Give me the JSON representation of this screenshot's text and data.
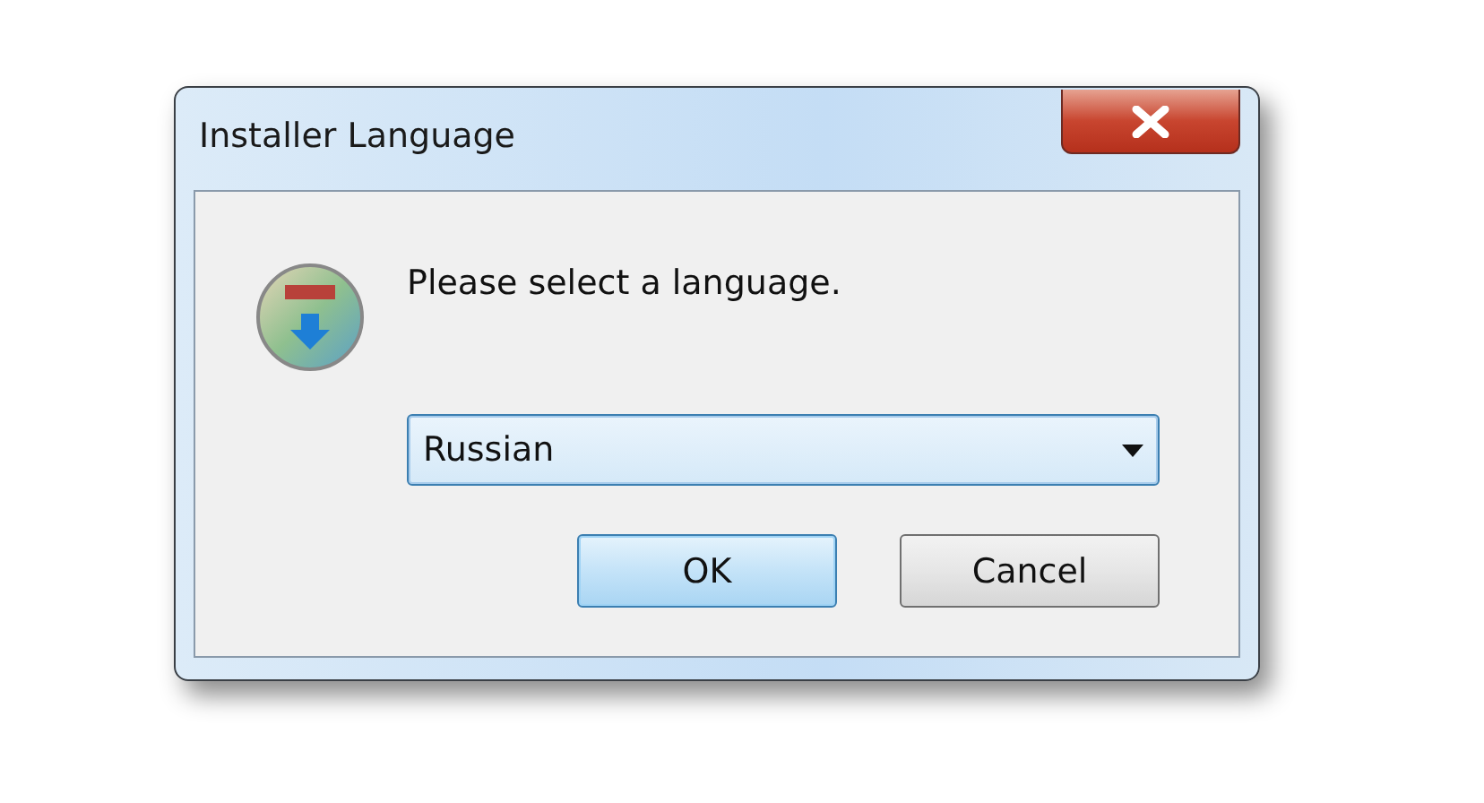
{
  "window": {
    "title": "Installer Language"
  },
  "message": "Please select a language.",
  "language_dropdown": {
    "value": "Russian",
    "focused": true
  },
  "buttons": [
    {
      "label": "OK",
      "default": true
    },
    {
      "label": "Cancel",
      "default": false
    }
  ]
}
